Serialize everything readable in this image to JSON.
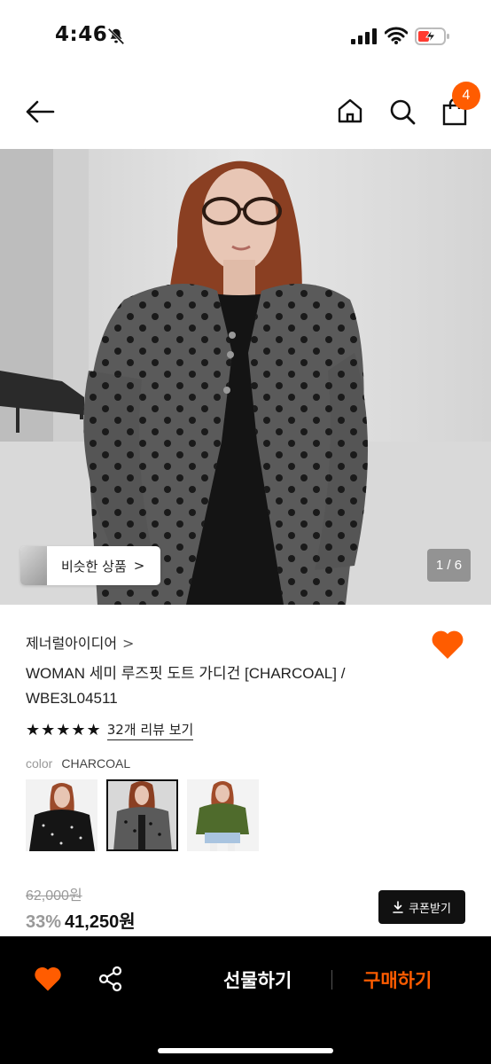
{
  "status_bar": {
    "time": "4:46"
  },
  "header": {
    "cart_count": "4"
  },
  "hero": {
    "similar_label": "비슷한 상품",
    "similar_chevron": ">",
    "page_indicator": "1 / 6"
  },
  "product": {
    "brand": "제너럴아이디어",
    "brand_chevron": ">",
    "title": "WOMAN 세미 루즈핏 도트 가디건 [CHARCOAL] / WBE3L04511",
    "stars": "★★★★★",
    "review_link": "32개 리뷰 보기",
    "color_label": "color",
    "color_value": "CHARCOAL",
    "swatches": [
      {
        "name": "black-dot"
      },
      {
        "name": "charcoal-dot"
      },
      {
        "name": "green"
      }
    ],
    "original_price": "62,000원",
    "discount": "33%",
    "final_price": "41,250원",
    "coupon_label": "쿠폰받기"
  },
  "bottom_bar": {
    "gift_label": "선물하기",
    "buy_label": "구매하기"
  },
  "colors": {
    "accent": "#ff5c00",
    "dark": "#111111",
    "muted": "#999999"
  }
}
